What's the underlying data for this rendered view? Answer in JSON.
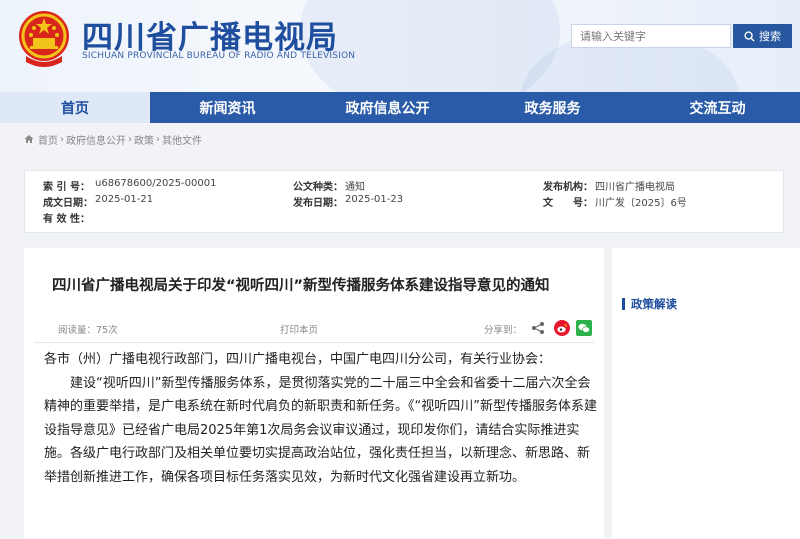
{
  "header": {
    "title": "四川省广播电视局",
    "subtitle": "SICHUAN PROVINCIAL BUREAU OF RADIO AND TELEVISION",
    "search_placeholder": "请输入关键字",
    "search_button": "搜索"
  },
  "nav": {
    "items": [
      "首页",
      "新闻资讯",
      "政府信息公开",
      "政务服务",
      "交流互动"
    ]
  },
  "breadcrumb": [
    "首页",
    "政府信息公开",
    "政策",
    "其他文件"
  ],
  "meta": {
    "index_label": "索 引 号：",
    "index_value": "u68678600/2025-00001",
    "doc_type_label": "公文种类：",
    "doc_type_value": "通知",
    "issuer_label": "发布机构：",
    "issuer_value": "四川省广播电视局",
    "date_label": "成文日期：",
    "date_value": "2025-01-21",
    "publish_label": "发布日期：",
    "publish_value": "2025-01-23",
    "docno_label": "文　　号：",
    "docno_value": "川广发〔2025〕6号",
    "validity_label": "有 效 性："
  },
  "article": {
    "title": "四川省广播电视局关于印发“视听四川”新型传播服务体系建设指导意见的通知",
    "views": "阅读量：75次",
    "print": "打印本页",
    "share": "分享到：",
    "paragraphs": [
      "各市（州）广播电视行政部门，四川广播电视台，中国广电四川分公司，有关行业协会：",
      "建设“视听四川”新型传播服务体系，是贯彻落实党的二十届三中全会和省委十二届六次全会精神的重要举措，是广电系统在新时代肩负的新职责和新任务。《“视听四川”新型传播服务体系建设指导意见》已经省广电局2025年第1次局务会议审议通过，现印发你们，请结合实际推进实施。各级广电行政部门及相关单位要切实提高政治站位，强化责任担当，以新理念、新思路、新举措创新推进工作，确保各项目标任务落实见效，为新时代文化强省建设再立新功。"
    ]
  },
  "sidebar": {
    "heading": "政策解读"
  },
  "colors": {
    "primary": "#2a5ba8",
    "title_blue": "#1f4e9e",
    "weibo_red": "#e6162d",
    "wechat_green": "#2bb24c"
  }
}
